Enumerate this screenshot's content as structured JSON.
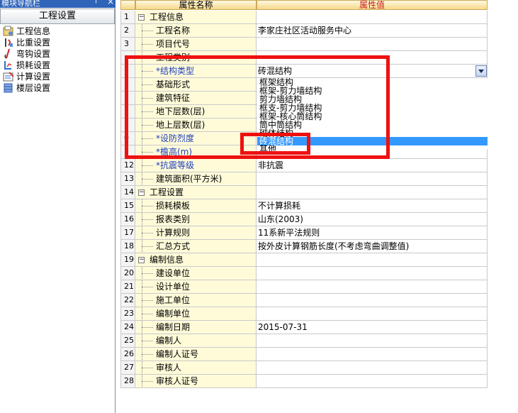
{
  "nav": {
    "title": "模块导航栏",
    "pin_glyph": "†",
    "close_glyph": "×",
    "header": "工程设置",
    "items": [
      {
        "label": "工程信息",
        "icon": "project-info-icon"
      },
      {
        "label": "比重设置",
        "icon": "weight-settings-icon"
      },
      {
        "label": "弯钩设置",
        "icon": "hook-settings-icon"
      },
      {
        "label": "损耗设置",
        "icon": "loss-settings-icon"
      },
      {
        "label": "计算设置",
        "icon": "calc-settings-icon"
      },
      {
        "label": "楼层设置",
        "icon": "floor-settings-icon"
      }
    ]
  },
  "grid": {
    "col_name": "属性名称",
    "col_value": "属性值",
    "rows": [
      {
        "num": "1",
        "name": "工程信息",
        "value": "",
        "type": "cat"
      },
      {
        "num": "2",
        "name": "工程名称",
        "value": "李家庄社区活动服务中心",
        "type": "item"
      },
      {
        "num": "3",
        "name": "项目代号",
        "value": "",
        "type": "item"
      },
      {
        "num": "",
        "name": "工程类别",
        "value": "",
        "type": "item"
      },
      {
        "num": "",
        "name": "*结构类型",
        "value": "砖混结构",
        "type": "req"
      },
      {
        "num": "",
        "name": "基础形式",
        "value": "",
        "type": "item"
      },
      {
        "num": "",
        "name": "建筑特征",
        "value": "",
        "type": "item"
      },
      {
        "num": "",
        "name": "地下层数(层)",
        "value": "",
        "type": "item"
      },
      {
        "num": "",
        "name": "地上层数(层)",
        "value": "",
        "type": "item"
      },
      {
        "num": "0",
        "name": "*设防烈度",
        "value": "",
        "type": "req"
      },
      {
        "num": "1",
        "name": "*檐高(m)",
        "value": "",
        "type": "req"
      },
      {
        "num": "12",
        "name": "*抗震等级",
        "value": "非抗震",
        "type": "req"
      },
      {
        "num": "13",
        "name": "建筑面积(平方米)",
        "value": "",
        "type": "item"
      },
      {
        "num": "14",
        "name": "工程设置",
        "value": "",
        "type": "cat"
      },
      {
        "num": "15",
        "name": "损耗模板",
        "value": "不计算损耗",
        "type": "item"
      },
      {
        "num": "16",
        "name": "报表类别",
        "value": "山东(2003)",
        "type": "item"
      },
      {
        "num": "17",
        "name": "计算规则",
        "value": "11系新平法规则",
        "type": "item"
      },
      {
        "num": "18",
        "name": "汇总方式",
        "value": "按外皮计算钢筋长度(不考虑弯曲调整值)",
        "type": "item"
      },
      {
        "num": "19",
        "name": "编制信息",
        "value": "",
        "type": "cat"
      },
      {
        "num": "20",
        "name": "建设单位",
        "value": "",
        "type": "item"
      },
      {
        "num": "21",
        "name": "设计单位",
        "value": "",
        "type": "item"
      },
      {
        "num": "22",
        "name": "施工单位",
        "value": "",
        "type": "item"
      },
      {
        "num": "23",
        "name": "编制单位",
        "value": "",
        "type": "item"
      },
      {
        "num": "24",
        "name": "编制日期",
        "value": "2015-07-31",
        "type": "item"
      },
      {
        "num": "25",
        "name": "编制人",
        "value": "",
        "type": "item"
      },
      {
        "num": "26",
        "name": "编制人证号",
        "value": "",
        "type": "item"
      },
      {
        "num": "27",
        "name": "审核人",
        "value": "",
        "type": "item"
      },
      {
        "num": "28",
        "name": "审核人证号",
        "value": "",
        "type": "item"
      }
    ]
  },
  "dropdown": {
    "options": [
      "框架结构",
      "框架-剪力墙结构",
      "剪力墙结构",
      "框支-剪力墙结构",
      "框架-核心筒结构",
      "筒中筒结构",
      "砌体结构"
    ],
    "selected": "砖混结构",
    "last": "其他"
  },
  "colors": {
    "highlight": "#ee1111",
    "selection": "#3399ff",
    "name_column": "#fffbd9"
  }
}
